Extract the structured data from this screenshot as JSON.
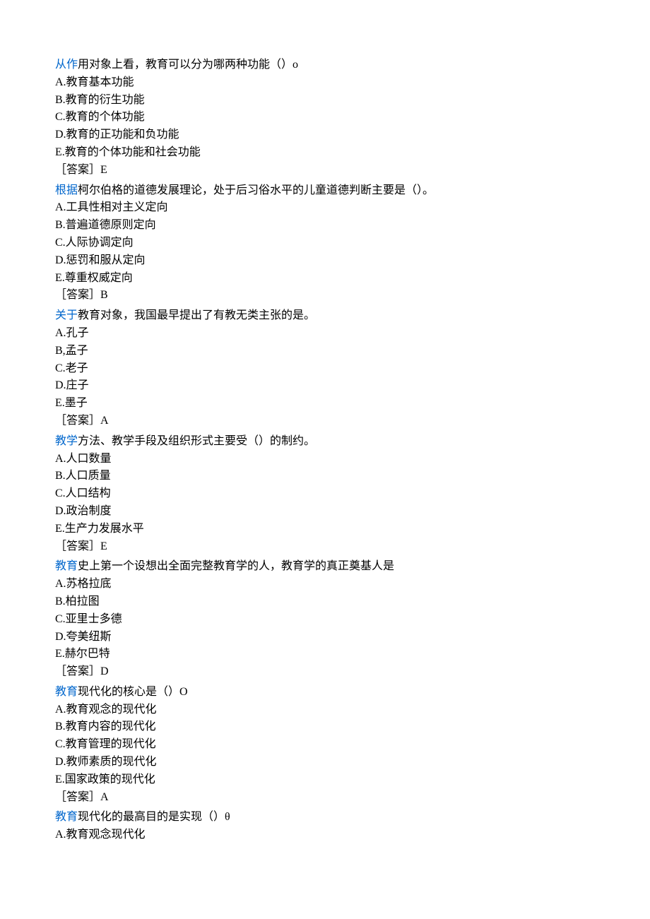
{
  "questions": [
    {
      "lead": "从作",
      "rest": "用对象上看，教育可以分为哪两种功能（）o",
      "options": [
        "A.教育基本功能",
        "B.教育的衍生功能",
        "C.教育的个体功能",
        "D.教育的正功能和负功能",
        "E.教育的个体功能和社会功能"
      ],
      "answer": "［答案］E"
    },
    {
      "lead": "根据",
      "rest": "柯尔伯格的道德发展理论，处于后习俗水平的儿童道德判断主要是（）。",
      "options": [
        "A.工具性相对主义定向",
        "B.普遍道德原则定向",
        "C.人际协调定向",
        "D.惩罚和服从定向",
        "E.尊重权威定向"
      ],
      "answer": "［答案］B"
    },
    {
      "lead": "关于",
      "rest": "教育对象，我国最早提出了有教无类主张的是。",
      "options": [
        "A.孔子",
        "B,孟子",
        "C.老子",
        "D.庄子",
        "E.墨子"
      ],
      "answer": "［答案］A"
    },
    {
      "lead": "教学",
      "rest": "方法、教学手段及组织形式主要受（）的制约。",
      "options": [
        "A.人口数量",
        "B.人口质量",
        "C.人口结构",
        "D.政治制度",
        "E.生产力发展水平"
      ],
      "answer": "［答案］E"
    },
    {
      "lead": "教育",
      "rest": "史上第一个设想出全面完整教育学的人，教育学的真正奠基人是",
      "options": [
        "A.苏格拉底",
        "B.柏拉图",
        "C.亚里士多德",
        "D.夸美纽斯",
        "E.赫尔巴特"
      ],
      "answer": "［答案］D"
    },
    {
      "lead": "教育",
      "rest": "现代化的核心是（）O",
      "options": [
        "A.教育观念的现代化",
        "B.教育内容的现代化",
        "C.教育管理的现代化",
        "D.教师素质的现代化",
        "E.国家政策的现代化"
      ],
      "answer": "［答案］A"
    },
    {
      "lead": "教育",
      "rest": "现代化的最高目的是实现（）θ",
      "options": [
        "A.教育观念现代化"
      ],
      "answer": ""
    }
  ]
}
